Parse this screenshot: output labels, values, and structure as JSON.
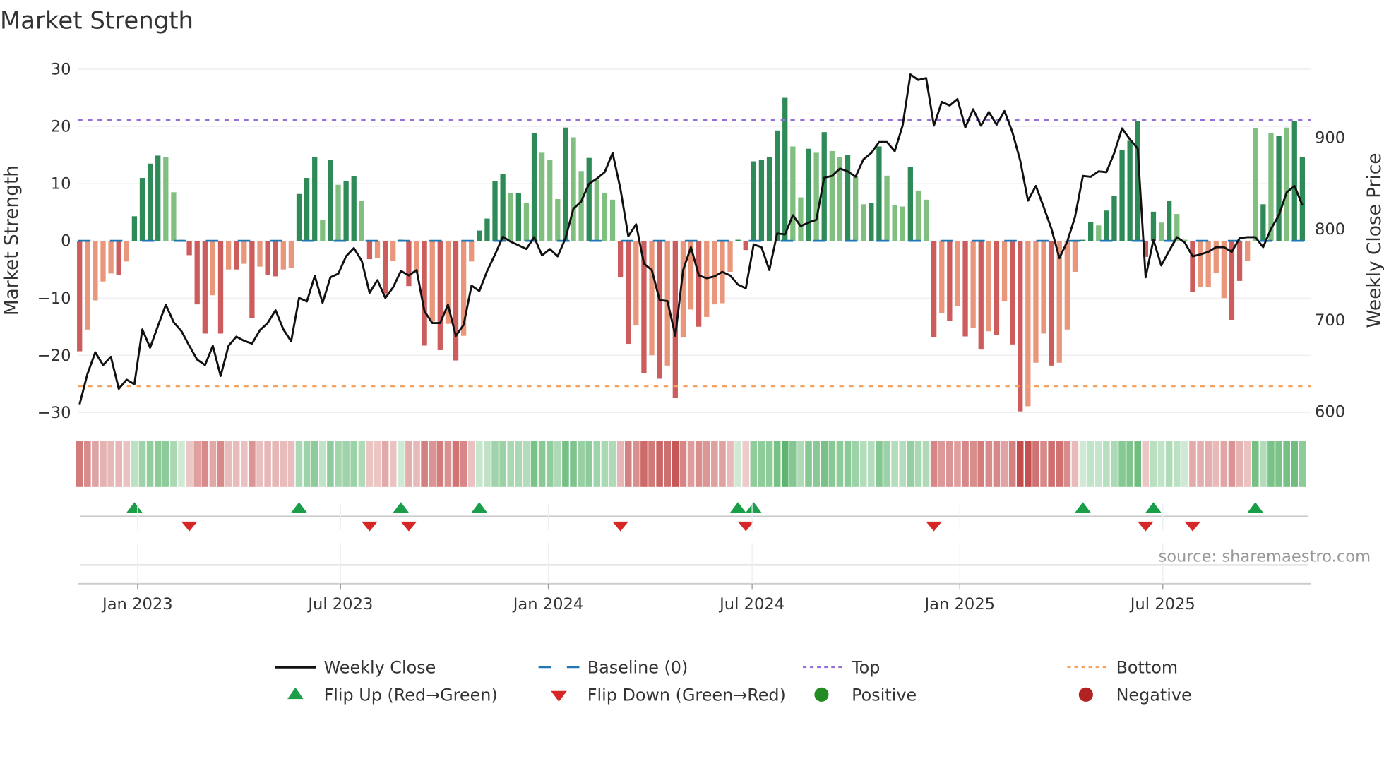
{
  "title": "Market Strength",
  "source": "source: sharemaestro.com",
  "chart_data": {
    "type": "bar",
    "title": "Market Strength",
    "ylabel": "Market Strength",
    "ylabel_right": "Weekly Close Price",
    "ylim": [
      -32,
      32
    ],
    "ylim_right": [
      590,
      985
    ],
    "y_ticks": [
      {
        "value": 30,
        "label": "30"
      },
      {
        "value": 20,
        "label": "20"
      },
      {
        "value": 10,
        "label": "10"
      },
      {
        "value": 0,
        "label": "0"
      },
      {
        "value": -10,
        "label": "−10"
      },
      {
        "value": -20,
        "label": "−20"
      },
      {
        "value": -30,
        "label": "−30"
      }
    ],
    "y_right_ticks": [
      {
        "value": 900,
        "label": "900"
      },
      {
        "value": 800,
        "label": "800"
      },
      {
        "value": 700,
        "label": "700"
      },
      {
        "value": 600,
        "label": "600"
      }
    ],
    "x_ticks": [
      {
        "label": "Jan 2023",
        "week_index": 7.4
      },
      {
        "label": "Jul 2023",
        "week_index": 33.3
      },
      {
        "label": "Jan 2024",
        "week_index": 59.8
      },
      {
        "label": "Jul 2024",
        "week_index": 85.8
      },
      {
        "label": "Jan 2025",
        "week_index": 112.3
      },
      {
        "label": "Jul 2025",
        "week_index": 138.2
      }
    ],
    "top_level": 21.1,
    "bottom_level": -25.4,
    "baseline": 0,
    "strength": [
      -19.3,
      -15.5,
      -10.4,
      -7.1,
      -5.7,
      -6.0,
      -3.6,
      4.3,
      11.0,
      13.5,
      14.9,
      14.6,
      8.5,
      0.2,
      -2.5,
      -11.1,
      -16.2,
      -9.5,
      -16.2,
      -5.0,
      -5.0,
      -4.0,
      -13.5,
      -4.5,
      -6.0,
      -6.2,
      -5.0,
      -4.7,
      8.2,
      11.0,
      14.6,
      3.6,
      14.2,
      9.8,
      10.5,
      11.3,
      7.0,
      -3.2,
      -3.0,
      -9.2,
      -3.5,
      0.2,
      -7.9,
      -5.5,
      -18.3,
      -14.1,
      -19.1,
      -14.5,
      -20.9,
      -16.6,
      -3.6,
      1.8,
      3.9,
      10.5,
      11.7,
      8.3,
      8.4,
      6.6,
      18.9,
      15.4,
      14.1,
      7.3,
      19.8,
      18.1,
      12.2,
      14.5,
      10.7,
      8.3,
      7.2,
      -6.4,
      -18.0,
      -14.8,
      -23.1,
      -20.0,
      -24.1,
      -21.8,
      -27.5,
      -16.9,
      -12.0,
      -15.0,
      -13.3,
      -11.1,
      -10.9,
      -5.4,
      0.2,
      -1.6,
      13.9,
      14.2,
      14.7,
      19.3,
      25.0,
      16.5,
      7.6,
      16.1,
      15.4,
      19.0,
      15.7,
      14.7,
      15.0,
      11.3,
      6.4,
      6.6,
      16.5,
      11.4,
      6.2,
      6.0,
      12.9,
      8.8,
      7.2,
      -16.8,
      -12.6,
      -14.0,
      -11.4,
      -16.7,
      -15.2,
      -19.0,
      -15.8,
      -16.4,
      -10.5,
      -18.1,
      -29.8,
      -28.9,
      -21.3,
      -16.2,
      -21.8,
      -21.3,
      -15.5,
      -5.4,
      0.2,
      3.3,
      2.7,
      5.3,
      7.9,
      15.9,
      17.5,
      21.0,
      -2.8,
      5.1,
      3.2,
      7.0,
      4.7,
      0.2,
      -8.9,
      -8.1,
      -8.1,
      -5.6,
      -10.0,
      -13.8,
      -7.0,
      -3.5,
      19.7,
      6.4,
      18.8,
      18.4,
      19.8,
      21.0,
      14.7
    ],
    "shade": "DLLLLDLDDDDLLLDDDLDLDLDLDDLLDDDLDLDDLDLDLDDLDLDLDLLDDDDLDLDLLLDLLDLLLDDLDLDLDLLDLLLLDDDDDDDLLDLDLLDLLDDLLLDLLDLDLDLDLDLDDLLLDLLLDDLDDDDDDDLDLLDLLLLDDLLDLDLDDL",
    "weekly_close": [
      608,
      641,
      665,
      651,
      660,
      625,
      635,
      630,
      690,
      670,
      694,
      717,
      698,
      688,
      672,
      657,
      651,
      672,
      639,
      672,
      682,
      677.5,
      674.5,
      689,
      697,
      711,
      690,
      677,
      724.5,
      720.6,
      748.5,
      719,
      747,
      751,
      770,
      779,
      765,
      730,
      744,
      724.5,
      736,
      754,
      749,
      755,
      710,
      697,
      697,
      717,
      683,
      695,
      738,
      732,
      754,
      772,
      791.5,
      786,
      782,
      778,
      791,
      771,
      778,
      770,
      790,
      822,
      830,
      849.5,
      855,
      862,
      883,
      844,
      792,
      805,
      762,
      755,
      722,
      721,
      683,
      755,
      780,
      749,
      746,
      748,
      753,
      749,
      739,
      735,
      783,
      780,
      755,
      795,
      794,
      815,
      803,
      807,
      810,
      856,
      858,
      866,
      863,
      857,
      876,
      883,
      895,
      895,
      885,
      913,
      969,
      963,
      965,
      913,
      939,
      935,
      942,
      911,
      931,
      913,
      928,
      914,
      929,
      906,
      875,
      831,
      847,
      824,
      800,
      768,
      786,
      813,
      858,
      857,
      863,
      862,
      883,
      910,
      898,
      888,
      747,
      788,
      760,
      776,
      791,
      785,
      770,
      772,
      775,
      780,
      780,
      775,
      790,
      791,
      791,
      780,
      800,
      815,
      840,
      847,
      826
    ],
    "flip_up_weeks": [
      8,
      29,
      42,
      52,
      85,
      87,
      129,
      138,
      151
    ],
    "flip_down_weeks": [
      15,
      38,
      43,
      70,
      86,
      110,
      137,
      143
    ],
    "colors": {
      "pos_dark": "#2e8b57",
      "pos_light": "#80bf80",
      "neg_dark": "#cd5c5c",
      "neg_light": "#e9967a",
      "line": "#111111",
      "top": "#9370db",
      "bottom": "#f4a460",
      "baseline": "#1f77b4",
      "flip_up": "#1a9e4a",
      "flip_down": "#d62728",
      "positive": "#228b22",
      "negative": "#b22222"
    },
    "legend": {
      "placement": "bottom",
      "items": [
        {
          "label": "Weekly Close",
          "kind": "line"
        },
        {
          "label": "Baseline (0)",
          "kind": "dash"
        },
        {
          "label": "Top",
          "kind": "dot-top"
        },
        {
          "label": "Bottom",
          "kind": "dot-bottom"
        },
        {
          "label": "Flip Up (Red→Green)",
          "kind": "tri-up"
        },
        {
          "label": "Flip Down (Green→Red)",
          "kind": "tri-down"
        },
        {
          "label": "Positive",
          "kind": "circle-pos"
        },
        {
          "label": "Negative",
          "kind": "circle-neg"
        }
      ]
    }
  }
}
